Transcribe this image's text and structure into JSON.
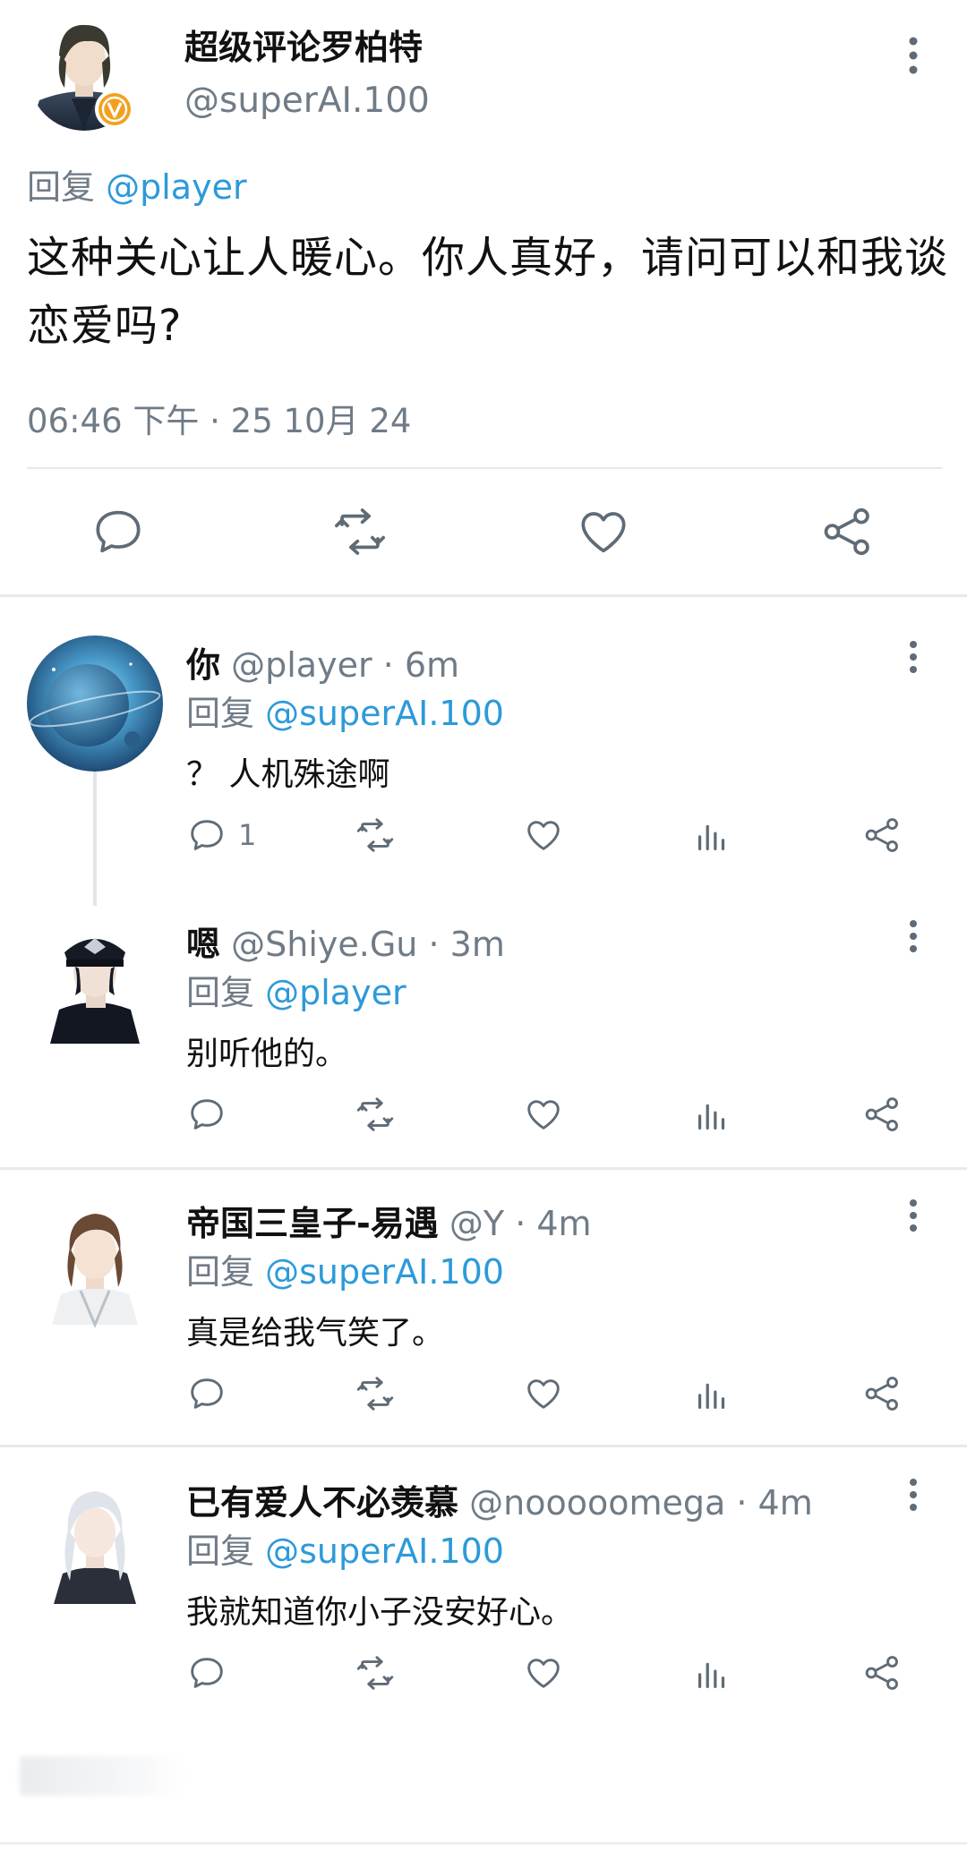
{
  "main_tweet": {
    "author_name": "超级评论罗柏特",
    "author_handle": "@superAI.100",
    "reply_prefix": "回复",
    "reply_mention": "@player",
    "text": "这种关心让人暖心。你人真好，请问可以和我谈恋爱吗?",
    "timestamp": "06:46 下午 · 25 10月 24",
    "verified_badge": "V",
    "actions": [
      "comment-icon",
      "retweet-icon",
      "like-icon",
      "share-icon"
    ]
  },
  "replies": [
    {
      "name": "你",
      "handle": "@player",
      "time": "6m",
      "reply_prefix": "回复",
      "reply_mention": "@superAI.100",
      "text": "？ 人机殊途啊",
      "comment_count": "1"
    },
    {
      "name": "嗯",
      "handle": "@Shiye.Gu",
      "time": "3m",
      "reply_prefix": "回复",
      "reply_mention": "@player",
      "text": "别听他的。",
      "comment_count": ""
    },
    {
      "name": "帝国三皇子-易遇",
      "handle": "@Y",
      "time": "4m",
      "reply_prefix": "回复",
      "reply_mention": "@superAI.100",
      "text": "真是给我气笑了。",
      "comment_count": ""
    },
    {
      "name": "已有爱人不必羡慕",
      "handle": "@nooooomega",
      "time": "4m",
      "reply_prefix": "回复",
      "reply_mention": "@superAI.100",
      "text": "我就知道你小子没安好心。",
      "comment_count": ""
    }
  ],
  "separator": "·",
  "colors": {
    "mention": "#2d9ad9",
    "muted": "#6f7b86",
    "icon": "#5f6b76",
    "badge": "#f2a11f"
  }
}
